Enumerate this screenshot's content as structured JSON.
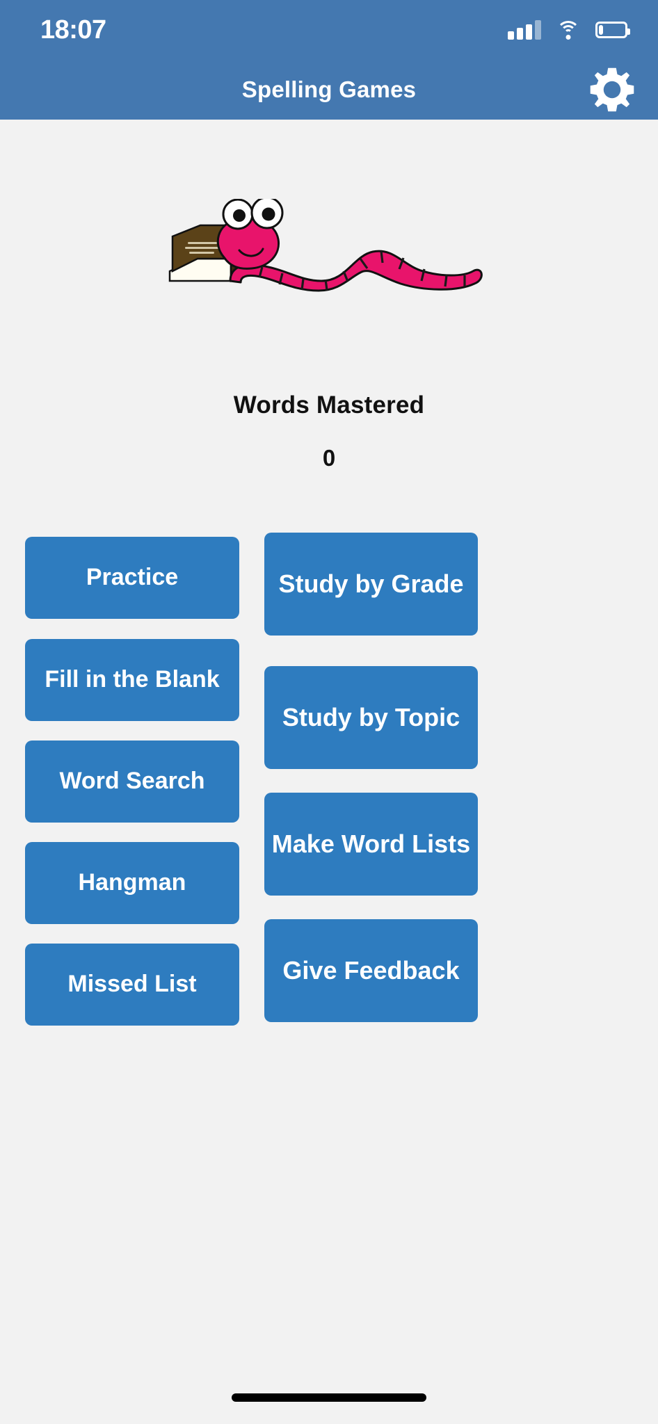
{
  "statusbar": {
    "time": "18:07",
    "signal_icon": "cellular-signal-icon",
    "wifi_icon": "wifi-icon",
    "battery_icon": "battery-icon",
    "battery_level_percent": 20
  },
  "appbar": {
    "title": "Spelling Games",
    "settings_icon": "gear-icon"
  },
  "mascot": {
    "name": "bookworm-illustration",
    "worm_color": "#E8146B",
    "book_color": "#5B4218"
  },
  "score": {
    "label": "Words Mastered",
    "value": "0"
  },
  "buttons": {
    "left_column": [
      {
        "label": "Practice",
        "name": "practice-button"
      },
      {
        "label": "Fill in the Blank",
        "name": "fill-in-the-blank-button"
      },
      {
        "label": "Word Search",
        "name": "word-search-button"
      },
      {
        "label": "Hangman",
        "name": "hangman-button"
      },
      {
        "label": "Missed List",
        "name": "missed-list-button"
      }
    ],
    "right_column": [
      {
        "label": "Study by Grade",
        "name": "study-by-grade-button"
      },
      {
        "label": "Study by Topic",
        "name": "study-by-topic-button"
      },
      {
        "label": "Make Word Lists",
        "name": "make-word-lists-button"
      },
      {
        "label": "Give Feedback",
        "name": "give-feedback-button"
      }
    ]
  },
  "colors": {
    "header_blue": "#4478B0",
    "button_blue": "#2E7CBF",
    "background": "#F2F2F2",
    "text_on_button": "#FFFFFF"
  },
  "home_indicator": "home-indicator-bar"
}
